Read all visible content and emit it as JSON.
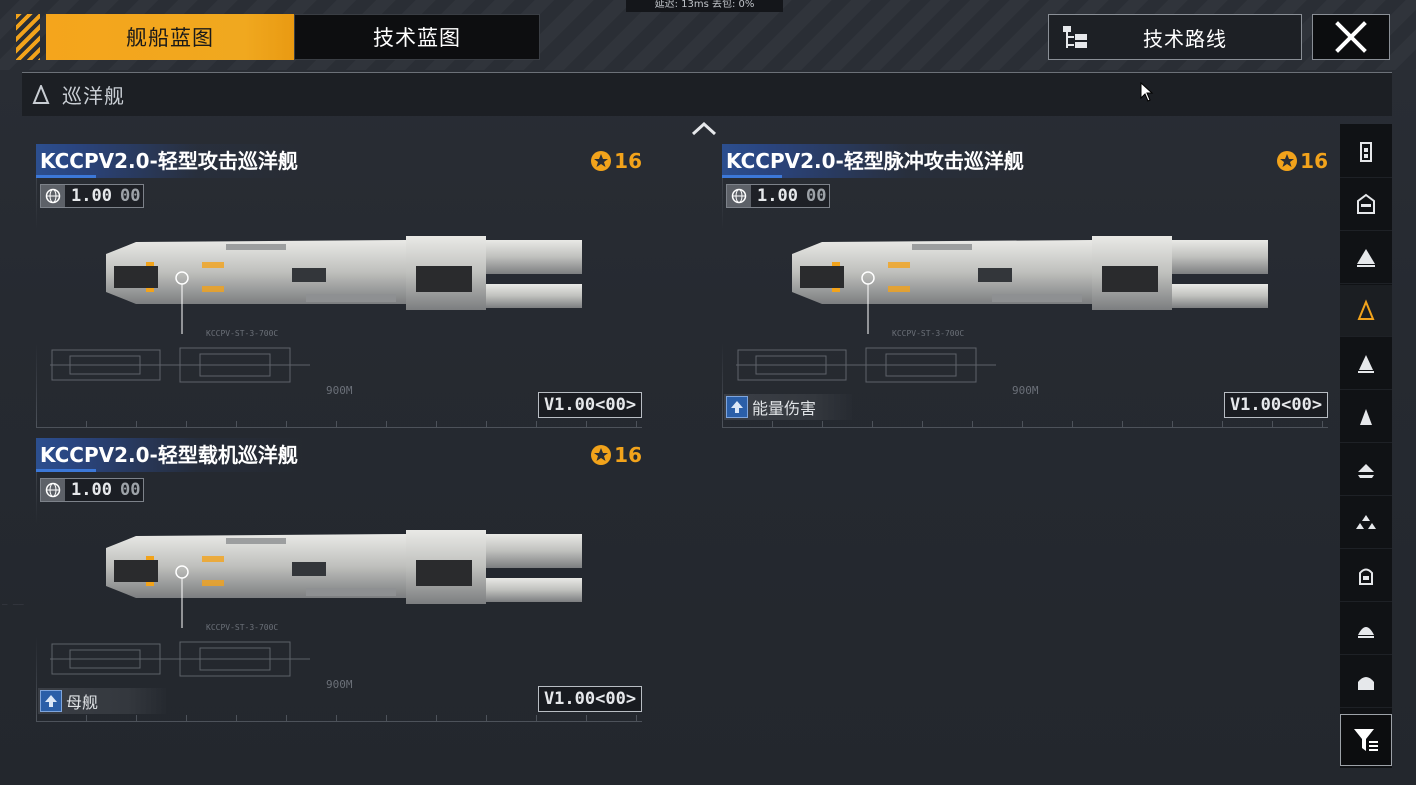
{
  "status_overlay": "延迟: 13ms  丢包: 0%",
  "tabs": [
    {
      "label": "舰船蓝图",
      "active": true
    },
    {
      "label": "技术蓝图",
      "active": false
    }
  ],
  "tech_route": {
    "label": "技术路线",
    "icon": "tree-icon"
  },
  "close": {
    "icon": "close-icon"
  },
  "category": {
    "label": "巡洋舰",
    "icon": "cruiser-icon"
  },
  "colors": {
    "accent": "#f2a31b",
    "title_blue": "#2c4f8f",
    "trait_blue": "#2b5fa8"
  },
  "cards": [
    {
      "title": "KCCPV2.0-轻型攻击巡洋舰",
      "level": "16",
      "version": "1.00",
      "version_suffix": "00",
      "tag": "V1.00<00>",
      "trait": null,
      "scale": "900M",
      "designation": "KCCPV-ST-3-700C"
    },
    {
      "title": "KCCPV2.0-轻型脉冲攻击巡洋舰",
      "level": "16",
      "version": "1.00",
      "version_suffix": "00",
      "tag": "V1.00<00>",
      "trait": {
        "label": "能量伤害",
        "icon": "energy-damage-icon"
      },
      "scale": "900M",
      "designation": "KCCPV-ST-3-700C"
    },
    {
      "title": "KCCPV2.0-轻型载机巡洋舰",
      "level": "16",
      "version": "1.00",
      "version_suffix": "00",
      "tag": "V1.00<00>",
      "trait": {
        "label": "母舰",
        "icon": "carrier-icon"
      },
      "scale": "900M",
      "designation": "KCCPV-ST-3-700C"
    }
  ],
  "sidebar": {
    "items": [
      {
        "icon": "battleship-icon",
        "active": false
      },
      {
        "icon": "auxiliary-ship-icon",
        "active": false
      },
      {
        "icon": "carrier-class-icon",
        "active": false
      },
      {
        "icon": "cruiser-icon",
        "active": true
      },
      {
        "icon": "destroyer-icon",
        "active": false
      },
      {
        "icon": "frigate-icon",
        "active": false
      },
      {
        "icon": "corvette-icon",
        "active": false
      },
      {
        "icon": "fighter-group-icon",
        "active": false
      },
      {
        "icon": "station-icon",
        "active": false
      },
      {
        "icon": "module-icon",
        "active": false
      },
      {
        "icon": "hull-icon",
        "active": false
      }
    ],
    "filter_icon": "filter-icon"
  }
}
